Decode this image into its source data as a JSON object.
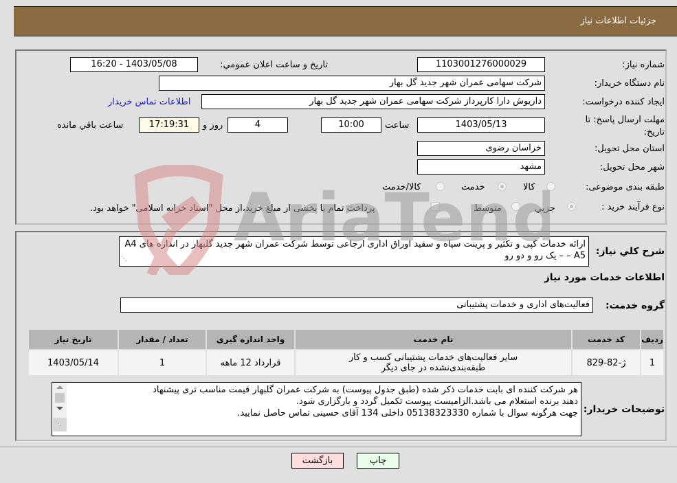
{
  "header": {
    "title": "جزئیات اطلاعات نیاز"
  },
  "form": {
    "need_number": {
      "label": "شماره نیاز:",
      "value": "1103001276000029"
    },
    "announce_datetime": {
      "label": "تاریخ و ساعت اعلان عمومي:",
      "value": "1403/05/08 - 16:20"
    },
    "buyer_org": {
      "label": "نام دستگاه خریدار:",
      "value": "شرکت سهامی عمران شهر جدید گل بهار"
    },
    "requester": {
      "label": "ایجاد کننده درخواست:",
      "value": "داریوش دارا کارپرداز شرکت سهامی عمران شهر جدید گل بهار"
    },
    "buyer_contact_link": "اطلاعات تماس خریدار",
    "deadline": {
      "label": "مهلت ارسال پاسخ: تا تاریخ:",
      "date": "1403/05/13",
      "time_label": "ساعت",
      "time": "10:00",
      "days": "4",
      "days_label": "روز و",
      "remaining": "17:19:31",
      "remaining_label": "ساعت باقي مانده"
    },
    "province": {
      "label": "استان محل تحویل:",
      "value": "خراسان رضوی"
    },
    "city": {
      "label": "شهر محل تحویل:",
      "value": "مشهد"
    },
    "category": {
      "label": "طبقه بندی موضوعی:",
      "options": [
        "کالا",
        "خدمت",
        "کالا/خدمت"
      ],
      "selected": "خدمت"
    },
    "purchase_type": {
      "label": "نوع فرآیند خرید :",
      "options": [
        "جزيي",
        "متوسط"
      ],
      "selected": "جزيي",
      "treasury_note": "پرداخت تمام یا بخشی از مبلغ خرید،از محل \"اسناد خزانه اسلامی\" خواهد بود."
    }
  },
  "description": {
    "label": "شرح کلي نیاز:",
    "value": "ارائه خدمات کپی و تکثیر و پرینت سیاه و سفید اوراق اداری ارجاعی توسط شرکت عمران شهر جدید گلبهار در اندازه های A4 – A5 – یک رو و دو رو"
  },
  "services": {
    "section_title": "اطلاعات خدمات مورد نیاز",
    "group_label": "گروه خدمت:",
    "group_value": "فعالیت‌های اداری و خدمات پشتیبانی",
    "columns": [
      "ردیف",
      "کد خدمت",
      "نام خدمت",
      "واحد اندازه گیری",
      "تعداد / مقدار",
      "تاریخ نیاز"
    ],
    "rows": [
      {
        "index": "1",
        "code": "ژ-82-829",
        "name": "سایر فعالیت‌های خدمات پشتیبانی کسب و کار طبقه‌بندی‌نشده در جای دیگر",
        "unit": "قرارداد 12 ماهه",
        "qty": "1",
        "date": "1403/05/14"
      }
    ]
  },
  "buyer_notes": {
    "label": "توضیحات خریدار:",
    "lines": [
      "هر شرکت کننده ای بابت خدمات ذکر شده (طبق جدول پیوست) به شرکت عمران گلبهار قیمت مناسب تری پیشنهاد",
      "دهند برنده استعلام می باشد.الزامیست پیوست تکمیل گردد و بارگزاری شود.",
      "جهت هرگونه سوال با شماره 05138323330 داخلی 134 آقای حسینی تماس حاصل نمایید."
    ]
  },
  "buttons": {
    "print": "چاپ",
    "back": "بازگشت"
  },
  "watermark": {
    "text": "AriaTender.neT"
  },
  "colors": {
    "title_bg": "#8b6b41",
    "link": "#1a1acc",
    "back_btn": "#ffdede",
    "print_btn": "#eaffea",
    "remaining_bg": "#fffbe6"
  }
}
